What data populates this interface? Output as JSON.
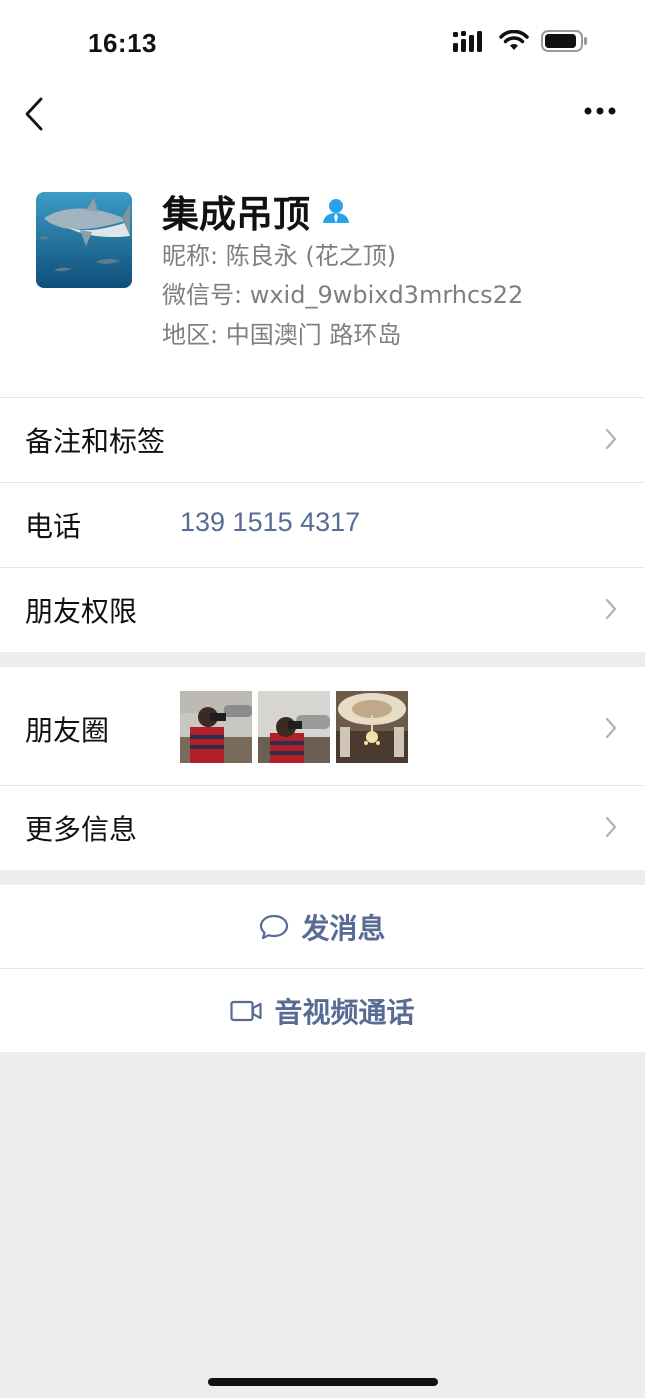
{
  "status_bar": {
    "time": "16:13"
  },
  "profile": {
    "name": "集成吊顶",
    "nickname": "昵称: 陈良永 (花之顶)",
    "wechat_id": "微信号: wxid_9wbixd3mrhcs22",
    "region": "地区: 中国澳门 路环岛"
  },
  "rows": {
    "remarks": "备注和标签",
    "phone_label": "电话",
    "phone_value": "139 1515 4317",
    "permissions": "朋友权限",
    "moments": "朋友圈",
    "more_info": "更多信息"
  },
  "actions": {
    "message": "发消息",
    "video_call": "音视频通话"
  },
  "colors": {
    "link": "#576b95",
    "background": "#ededed",
    "badge": "#2aa3ec"
  }
}
